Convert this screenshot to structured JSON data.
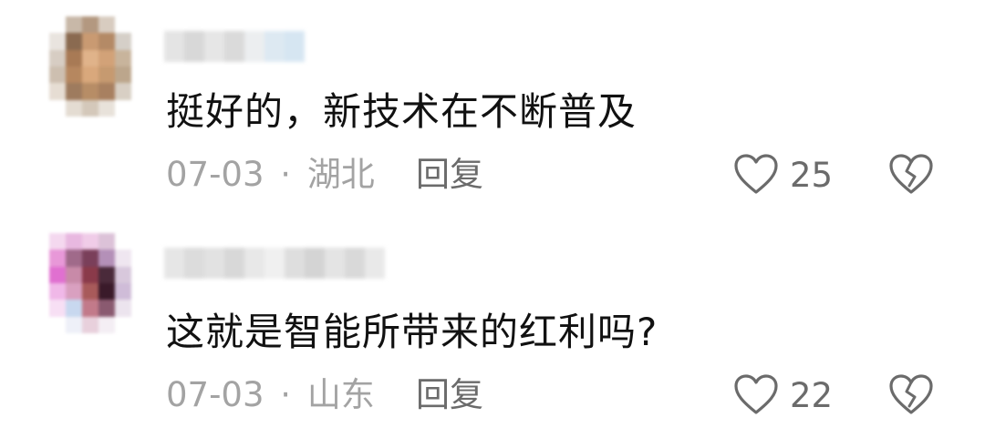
{
  "comments": [
    {
      "text": "挺好的，新技术在不断普及",
      "date": "07-03",
      "separator": "·",
      "location": "湖北",
      "reply_label": "回复",
      "likes": "25",
      "like_icon": "heart-outline-icon",
      "dislike_icon": "broken-heart-icon"
    },
    {
      "text": "这就是智能所带来的红利吗?",
      "date": "07-03",
      "separator": "·",
      "location": "山东",
      "reply_label": "回复",
      "likes": "22",
      "like_icon": "heart-outline-icon",
      "dislike_icon": "broken-heart-icon"
    }
  ],
  "colors": {
    "text": "#111111",
    "meta": "#a3a3a3",
    "action": "#6b6b6b",
    "icon": "#6b6b6b"
  }
}
